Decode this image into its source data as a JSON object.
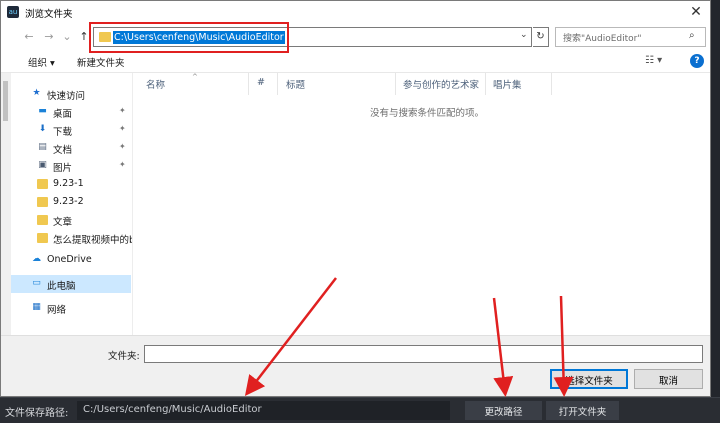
{
  "dialog": {
    "title": "浏览文件夹",
    "close": "✕",
    "app_icon_text": "au"
  },
  "nav": {
    "back": "←",
    "forward": "→",
    "history": "⌄",
    "up": "↑",
    "address": "C:\\Users\\cenfeng\\Music\\AudioEditor",
    "dropdown": "⌄",
    "refresh": "↻",
    "search_placeholder": "搜索\"AudioEditor\"",
    "search_icon": "⌕"
  },
  "toolbar": {
    "organize": "组织 ▾",
    "new_folder": "新建文件夹",
    "view": "☷ ▾",
    "help": "?"
  },
  "sidebar": {
    "items": [
      {
        "label": "快速访问",
        "icon": "star-icon",
        "glyph": "★"
      },
      {
        "label": "桌面",
        "icon": "desktop-icon",
        "glyph": "▬",
        "pinned": true
      },
      {
        "label": "下载",
        "icon": "download-icon",
        "glyph": "⬇",
        "pinned": true
      },
      {
        "label": "文档",
        "icon": "document-icon",
        "glyph": "▤",
        "pinned": true
      },
      {
        "label": "图片",
        "icon": "picture-icon",
        "glyph": "▣",
        "pinned": true
      },
      {
        "label": "9.23-1",
        "icon": "folder-icon"
      },
      {
        "label": "9.23-2",
        "icon": "folder-icon"
      },
      {
        "label": "文章",
        "icon": "folder-icon"
      },
      {
        "label": "怎么提取视频中的b",
        "icon": "folder-icon"
      },
      {
        "label": "OneDrive",
        "icon": "cloud-icon",
        "glyph": "☁"
      },
      {
        "label": "此电脑",
        "icon": "computer-icon",
        "glyph": "▭",
        "selected": true
      },
      {
        "label": "网络",
        "icon": "network-icon",
        "glyph": "▦"
      }
    ],
    "pin_glyph": "📌"
  },
  "columns": [
    "名称",
    "#",
    "标题",
    "参与创作的艺术家",
    "唱片集"
  ],
  "sort_glyph": "^",
  "empty_message": "没有与搜索条件匹配的项。",
  "bottom": {
    "folder_label": "文件夹:",
    "folder_value": "",
    "select_button": "选择文件夹",
    "cancel_button": "取消"
  },
  "app": {
    "save_path_label": "文件保存路径:",
    "save_path": "C:/Users/cenfeng/Music/AudioEditor",
    "change_path_button": "更改路径",
    "open_folder_button": "打开文件夹"
  },
  "colors": {
    "highlight": "#0078d7",
    "annotation_red": "#e02020",
    "app_dark": "#2a2d33"
  }
}
